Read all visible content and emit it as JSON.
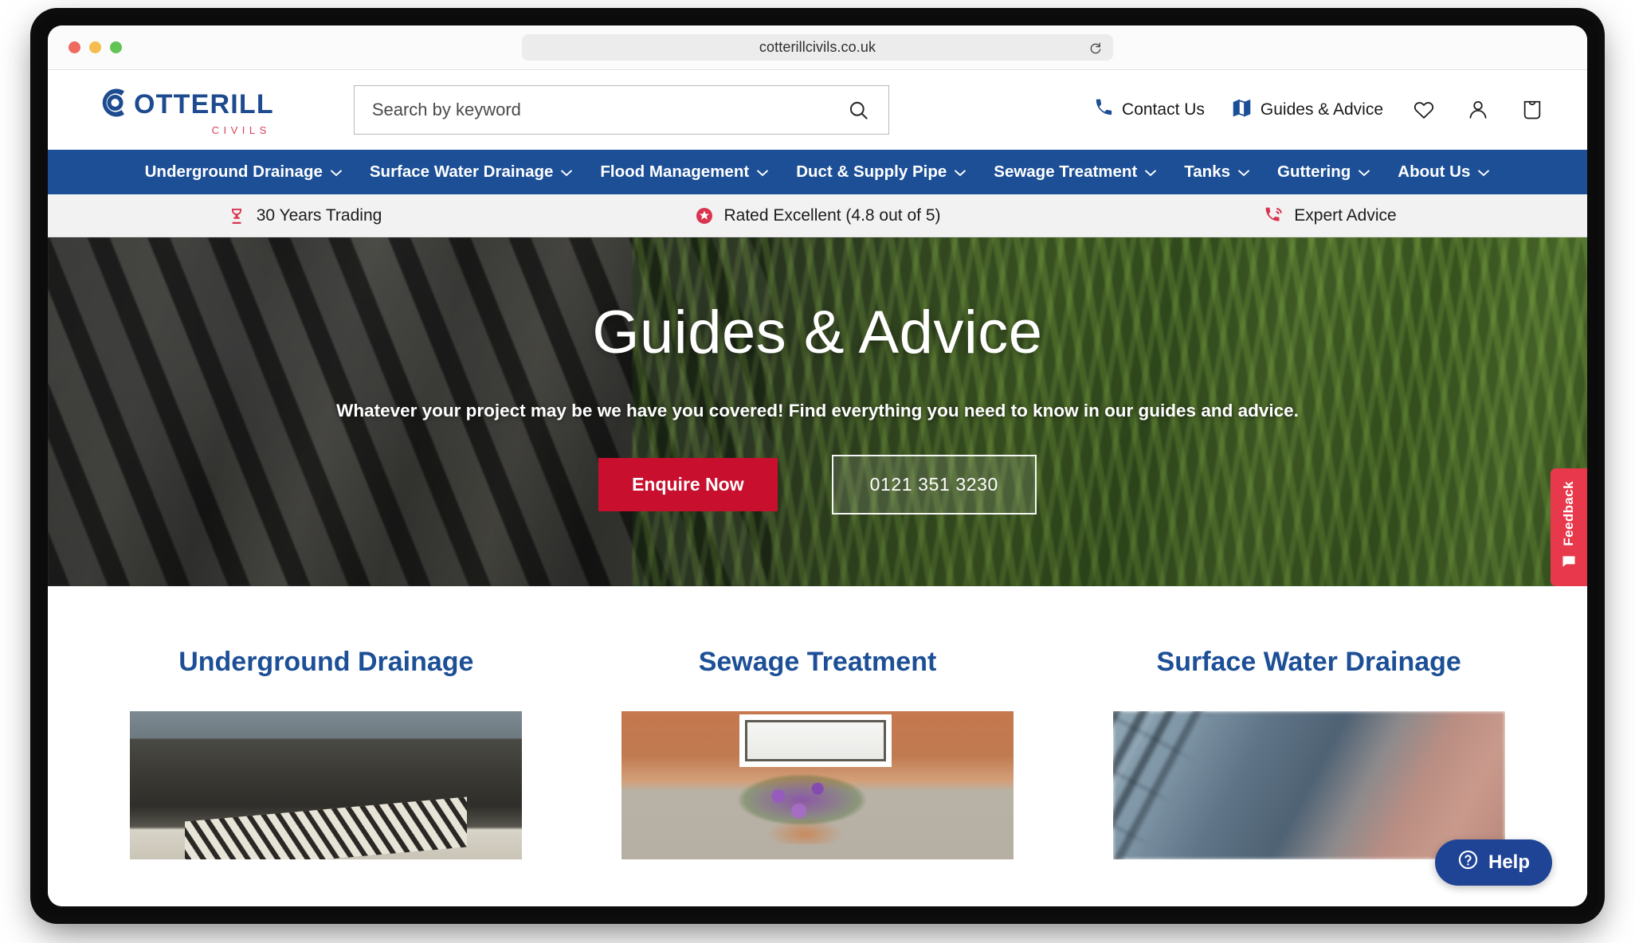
{
  "browser": {
    "url": "cotterillcivils.co.uk",
    "reload_icon": "reload-icon",
    "traffic_lights": [
      "close",
      "minimize",
      "maximize"
    ]
  },
  "header": {
    "logo": {
      "word": "OTTERILL",
      "sub": "CIVILS",
      "mark": "c-o-monogram"
    },
    "search": {
      "placeholder": "Search by keyword",
      "value": "",
      "icon": "search-icon"
    },
    "links": [
      {
        "label": "Contact Us",
        "icon": "phone-icon"
      },
      {
        "label": "Guides & Advice",
        "icon": "map-book-icon"
      }
    ],
    "icons": [
      {
        "name": "wishlist-heart-icon"
      },
      {
        "name": "account-person-icon"
      },
      {
        "name": "cart-bag-icon"
      }
    ]
  },
  "nav": {
    "items": [
      {
        "label": "Underground Drainage",
        "caret": "chevron-down-icon"
      },
      {
        "label": "Surface Water Drainage",
        "caret": "chevron-down-icon"
      },
      {
        "label": "Flood Management",
        "caret": "chevron-down-icon"
      },
      {
        "label": "Duct & Supply Pipe",
        "caret": "chevron-down-icon"
      },
      {
        "label": "Sewage Treatment",
        "caret": "chevron-down-icon"
      },
      {
        "label": "Tanks",
        "caret": "chevron-down-icon"
      },
      {
        "label": "Guttering",
        "caret": "chevron-down-icon"
      },
      {
        "label": "About Us",
        "caret": "chevron-down-icon"
      }
    ]
  },
  "trustbar": {
    "items": [
      {
        "label": "30 Years Trading",
        "icon": "trophy-icon"
      },
      {
        "label": "Rated Excellent (4.8 out of 5)",
        "icon": "star-badge-icon"
      },
      {
        "label": "Expert Advice",
        "icon": "phone-ring-icon"
      }
    ]
  },
  "hero": {
    "title": "Guides & Advice",
    "subtitle": "Whatever your project may be we have you covered! Find everything you need to know in our guides and advice.",
    "primary_cta": "Enquire Now",
    "phone_cta": "0121 351 3230"
  },
  "feedback": {
    "label": "Feedback",
    "icon": "feedback-icon"
  },
  "categories": [
    {
      "title": "Underground Drainage",
      "image": "construction-dig-photo"
    },
    {
      "title": "Sewage Treatment",
      "image": "garden-house-photo"
    },
    {
      "title": "Surface Water Drainage",
      "image": "paving-channel-photo"
    }
  ],
  "help": {
    "label": "Help",
    "icon": "question-circle-icon"
  },
  "colors": {
    "brand_blue": "#1c4f96",
    "brand_red": "#c8102e",
    "accent_red": "#d9344f",
    "nav_bg": "#1c4f96",
    "trust_bg": "#f2f2f2",
    "help_blue": "#1f4496"
  }
}
